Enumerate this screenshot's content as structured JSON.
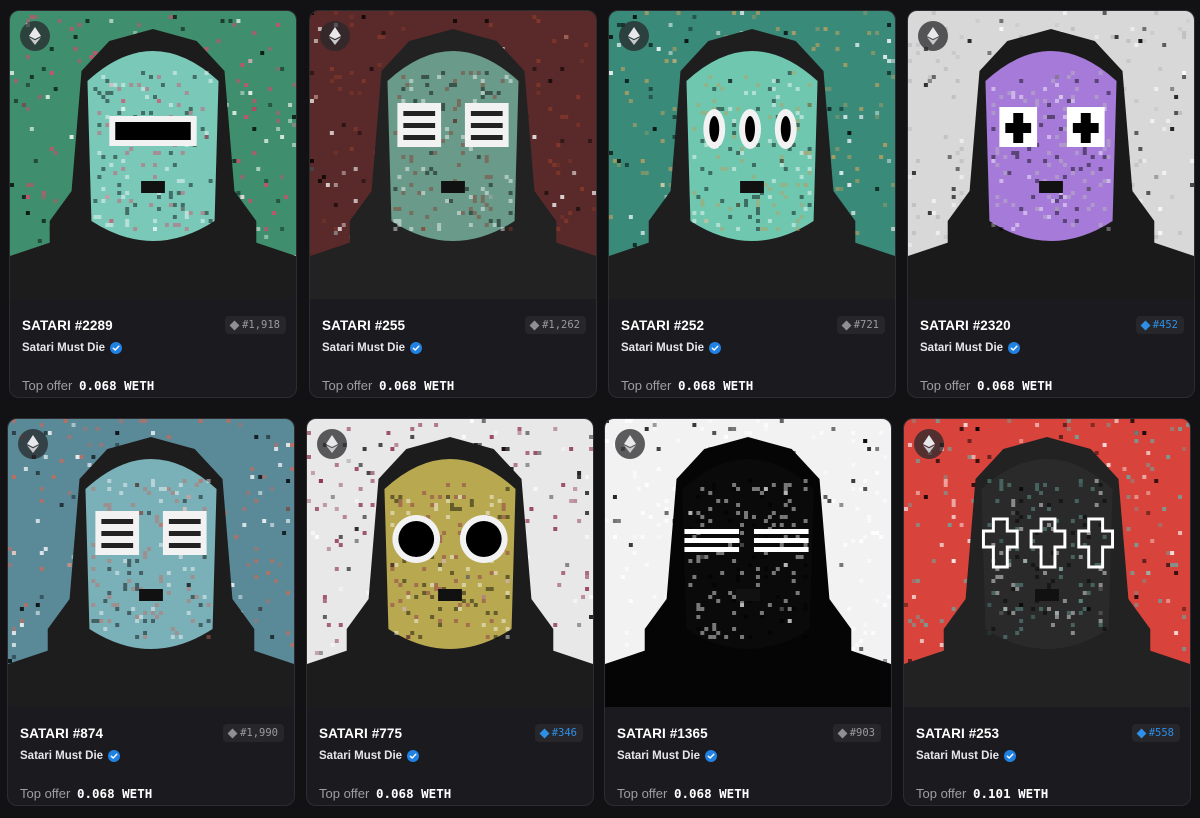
{
  "cards": [
    {
      "name": "SATARI #2289",
      "collection": "Satari Must Die",
      "rank": "#1,918",
      "rare": false,
      "offer_label": "Top offer",
      "offer_value": "0.068 WETH",
      "art": {
        "bg": "#3f8f6e",
        "bg2": "#d94a6a",
        "mask": "#7ac9b8",
        "eyes": "bar",
        "hood": "#1c1c1c"
      }
    },
    {
      "name": "SATARI #255",
      "collection": "Satari Must Die",
      "rank": "#1,262",
      "rare": false,
      "offer_label": "Top offer",
      "offer_value": "0.068 WETH",
      "art": {
        "bg": "#5a2a2a",
        "bg2": "#8a3a2a",
        "mask": "#6a9a8a",
        "eyes": "boxes",
        "hood": "#222222"
      }
    },
    {
      "name": "SATARI #252",
      "collection": "Satari Must Die",
      "rank": "#721",
      "rare": false,
      "offer_label": "Top offer",
      "offer_value": "0.068 WETH",
      "art": {
        "bg": "#3a8a7a",
        "bg2": "#b8a060",
        "mask": "#6fc7b0",
        "eyes": "three",
        "hood": "#1e1e1e"
      }
    },
    {
      "name": "SATARI #2320",
      "collection": "Satari Must Die",
      "rank": "#452",
      "rare": true,
      "offer_label": "Top offer",
      "offer_value": "0.068 WETH",
      "art": {
        "bg": "#d8d8d8",
        "bg2": "#bdbdbd",
        "mask": "#a57ad8",
        "eyes": "cross",
        "hood": "#1a1a1a"
      }
    },
    {
      "name": "SATARI #874",
      "collection": "Satari Must Die",
      "rank": "#1,990",
      "rare": false,
      "offer_label": "Top offer",
      "offer_value": "0.068 WETH",
      "art": {
        "bg": "#5a8a98",
        "bg2": "#c86a5a",
        "mask": "#7ab0b8",
        "eyes": "boxes",
        "hood": "#1d1d1d"
      }
    },
    {
      "name": "SATARI #775",
      "collection": "Satari Must Die",
      "rank": "#346",
      "rare": true,
      "offer_label": "Top offer",
      "offer_value": "0.068 WETH",
      "art": {
        "bg": "#e8e8e8",
        "bg2": "#8a2a4a",
        "mask": "#b8a850",
        "eyes": "round",
        "hood": "#1c1c1c"
      }
    },
    {
      "name": "SATARI #1365",
      "collection": "Satari Must Die",
      "rank": "#903",
      "rare": false,
      "offer_label": "Top offer",
      "offer_value": "0.068 WETH",
      "art": {
        "bg": "#f2f2f2",
        "bg2": "#ffffff",
        "mask": "#0a0a0a",
        "eyes": "lines",
        "hood": "#050505"
      }
    },
    {
      "name": "SATARI #253",
      "collection": "Satari Must Die",
      "rank": "#558",
      "rare": true,
      "offer_label": "Top offer",
      "offer_value": "0.101 WETH",
      "art": {
        "bg": "#d8443c",
        "bg2": "#6aa8a0",
        "mask": "#2a2a2a",
        "eyes": "cross-outline",
        "hood": "#222222"
      }
    }
  ]
}
